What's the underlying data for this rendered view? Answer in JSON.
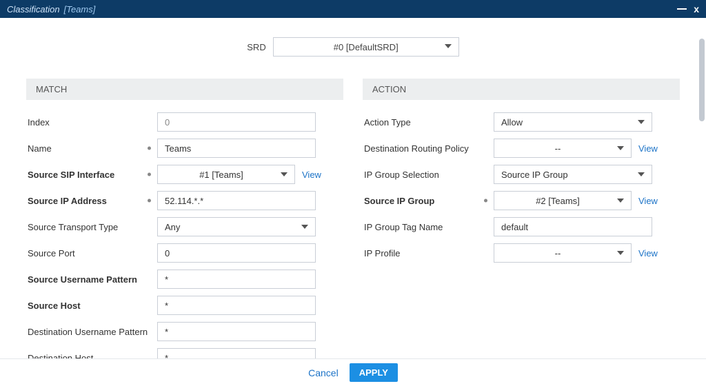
{
  "window": {
    "title_main": "Classification",
    "title_sub": "[Teams]"
  },
  "srd": {
    "label": "SRD",
    "value": "#0 [DefaultSRD]"
  },
  "sections": {
    "match_header": "MATCH",
    "action_header": "ACTION"
  },
  "match": {
    "index_label": "Index",
    "index_value": "0",
    "name_label": "Name",
    "name_value": "Teams",
    "src_sip_if_label": "Source SIP Interface",
    "src_sip_if_value": "#1 [Teams]",
    "src_ip_label": "Source IP Address",
    "src_ip_value": "52.114.*.*",
    "src_transport_label": "Source Transport Type",
    "src_transport_value": "Any",
    "src_port_label": "Source Port",
    "src_port_value": "0",
    "src_user_pat_label": "Source Username Pattern",
    "src_user_pat_value": "*",
    "src_host_label": "Source Host",
    "src_host_value": "*",
    "dst_user_pat_label": "Destination Username Pattern",
    "dst_user_pat_value": "*",
    "dst_host_label": "Destination Host",
    "dst_host_value": "*"
  },
  "action": {
    "action_type_label": "Action Type",
    "action_type_value": "Allow",
    "dst_routing_label": "Destination Routing Policy",
    "dst_routing_value": "--",
    "ip_group_sel_label": "IP Group Selection",
    "ip_group_sel_value": "Source IP Group",
    "src_ip_group_label": "Source IP Group",
    "src_ip_group_value": "#2 [Teams]",
    "ip_group_tag_label": "IP Group Tag Name",
    "ip_group_tag_value": "default",
    "ip_profile_label": "IP Profile",
    "ip_profile_value": "--"
  },
  "links": {
    "view": "View"
  },
  "footer": {
    "cancel": "Cancel",
    "apply": "APPLY"
  }
}
